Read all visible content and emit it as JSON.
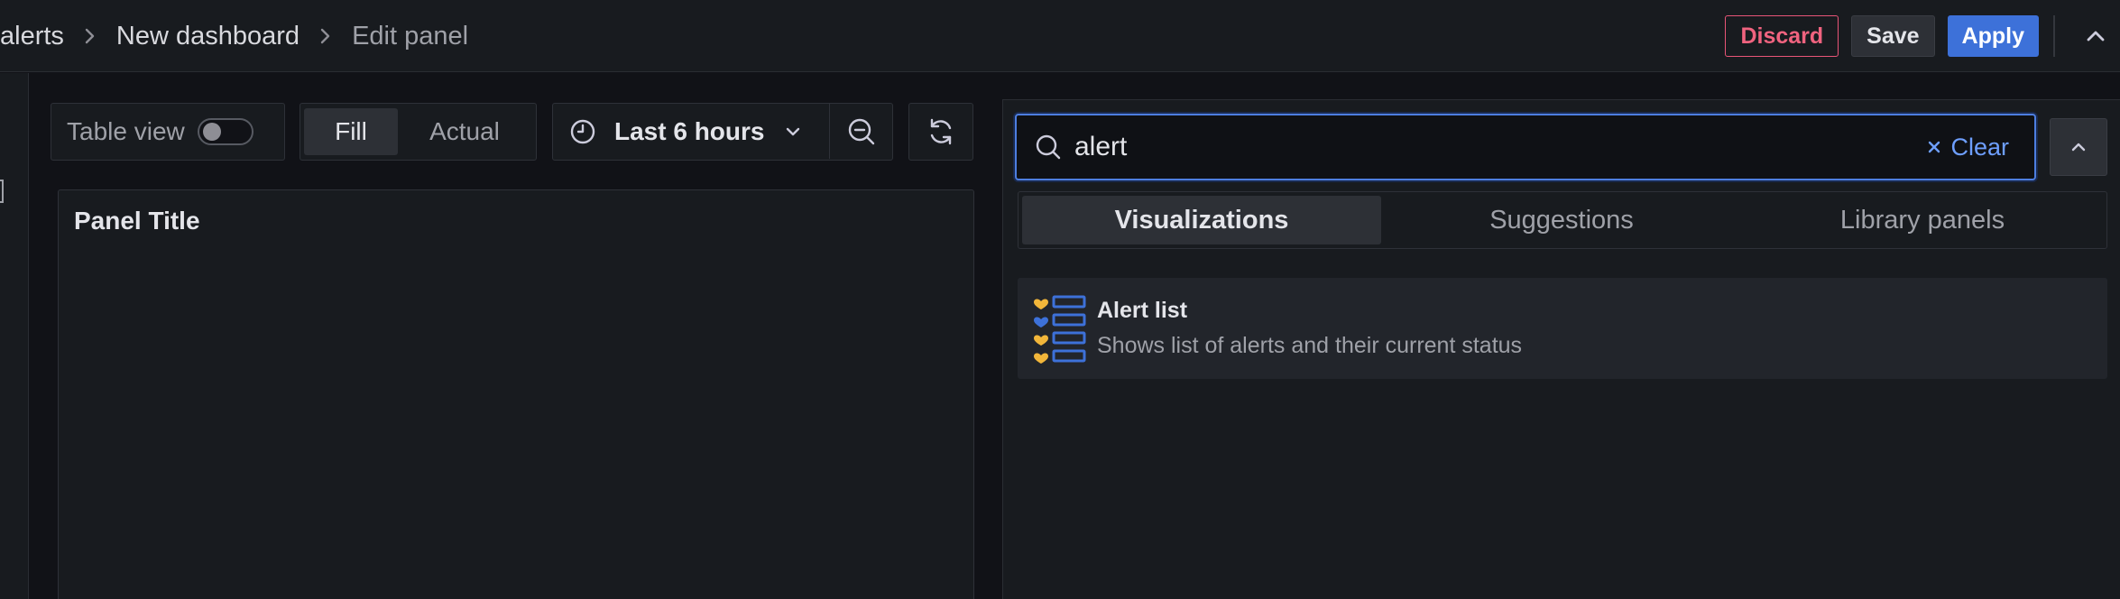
{
  "breadcrumb": {
    "items": [
      "alerts",
      "New dashboard",
      "Edit panel"
    ]
  },
  "toolbar": {
    "discard_label": "Discard",
    "save_label": "Save",
    "apply_label": "Apply"
  },
  "preview_controls": {
    "table_view_label": "Table view",
    "table_view_on": false,
    "fill_label": "Fill",
    "actual_label": "Actual",
    "selected_mode": "Fill",
    "time_range_label": "Last 6 hours"
  },
  "panel": {
    "title": "Panel Title"
  },
  "viz_picker": {
    "search_value": "alert",
    "clear_label": "Clear",
    "tabs": [
      {
        "label": "Visualizations",
        "active": true
      },
      {
        "label": "Suggestions",
        "active": false
      },
      {
        "label": "Library panels",
        "active": false
      }
    ],
    "results": [
      {
        "title": "Alert list",
        "description": "Shows list of alerts and their current status",
        "icon": "alert-list-icon"
      }
    ]
  },
  "colors": {
    "background": "#111217",
    "surface": "#181b1f",
    "accent": "#3d71d9",
    "discard": "#e85577",
    "link": "#6e9fff"
  }
}
